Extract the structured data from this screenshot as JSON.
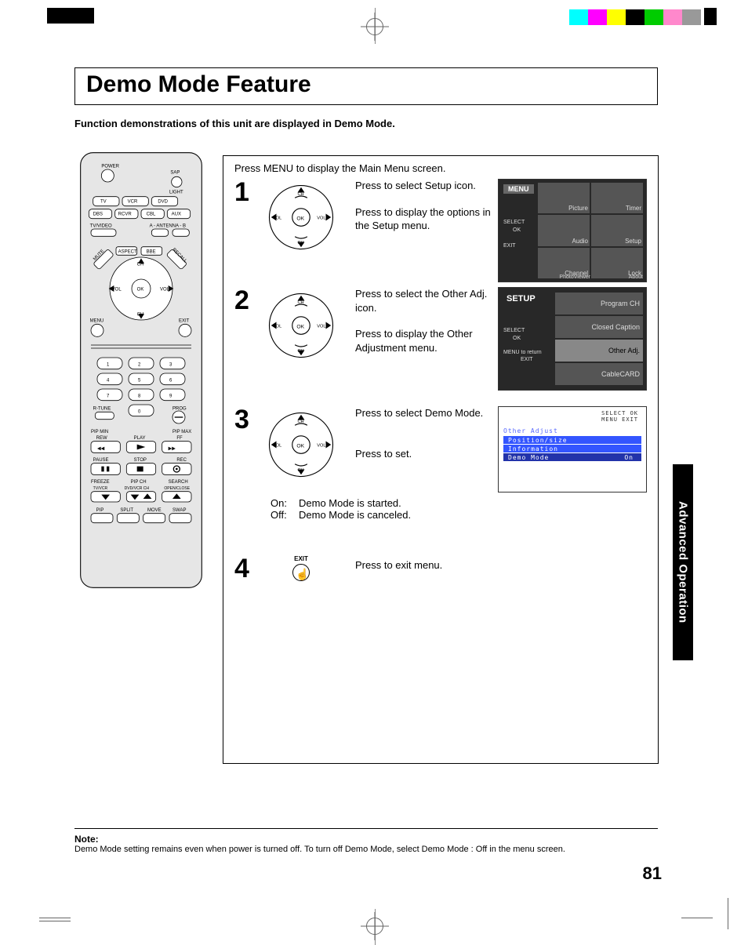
{
  "page": {
    "title": "Demo Mode Feature",
    "subtitle": "Function demonstrations of this unit are displayed in Demo Mode.",
    "page_number": "81",
    "side_tab": "Advanced Operation"
  },
  "intro": "Press MENU to display the Main Menu screen.",
  "steps": [
    {
      "num": "1",
      "text_a": "Press to select Setup icon.",
      "text_b": "Press to display the options in the Setup menu."
    },
    {
      "num": "2",
      "text_a": "Press to select the Other Adj. icon.",
      "text_b": "Press to display the Other Adjustment menu."
    },
    {
      "num": "3",
      "text_a": "Press to select Demo Mode.",
      "text_b": "Press to set."
    },
    {
      "num": "4",
      "text_a": "Press to exit menu."
    }
  ],
  "onoff": {
    "on_label": "On:",
    "on_text": "Demo Mode is started.",
    "off_label": "Off:",
    "off_text": "Demo Mode is canceled."
  },
  "exit_label": "EXIT",
  "nav_labels": {
    "ch": "CH",
    "vol": "VOL",
    "ok": "OK"
  },
  "screen_menu": {
    "header": "MENU",
    "items": [
      "Picture",
      "Timer",
      "Audio",
      "Setup",
      "Channel",
      "Lock",
      "PhotoViewer",
      "About"
    ],
    "side": [
      "SELECT",
      "OK",
      "EXIT"
    ]
  },
  "screen_setup": {
    "header": "SETUP",
    "items": [
      "Program CH",
      "Closed Caption",
      "Other Adj.",
      "CableCARD"
    ],
    "hl_index": 2,
    "side": [
      "SELECT",
      "OK",
      "MENU to return",
      "EXIT"
    ]
  },
  "screen_osd": {
    "legend_top": "SELECT    OK",
    "legend_bot": "MENU    EXIT",
    "title": "Other Adjust",
    "rows": [
      {
        "label": "Position/size",
        "val": ""
      },
      {
        "label": "Information",
        "val": ""
      },
      {
        "label": "Demo Mode",
        "val": "On"
      }
    ]
  },
  "note": {
    "label": "Note:",
    "text": "Demo Mode setting remains even when power is turned off. To turn off Demo Mode, select Demo Mode : Off in the menu screen."
  },
  "remote": {
    "power": "POWER",
    "sap": "SAP",
    "light": "LIGHT",
    "src_row1": [
      "TV",
      "VCR",
      "DVD"
    ],
    "src_row2": [
      "DBS",
      "RCVR",
      "CBL",
      "AUX"
    ],
    "tvvideo": "TV/VIDEO",
    "antenna": "A - ANTENNA - B",
    "mute": "MUTE",
    "aspect": "ASPECT",
    "bbe": "BBE",
    "recall": "RECALL",
    "ch": "CH",
    "vol": "VOL",
    "ok": "OK",
    "menu": "MENU",
    "exit": "EXIT",
    "rtune": "R-TUNE",
    "prog": "PROG",
    "pipmin": "PIP MIN",
    "pipmax": "PIP MAX",
    "rew": "REW",
    "play": "PLAY",
    "ff": "FF",
    "pause": "PAUSE",
    "stop": "STOP",
    "rec": "REC",
    "freeze": "FREEZE",
    "pipch": "PIP CH",
    "search": "SEARCH",
    "tvvcr": "TV/VCR",
    "dvdvcr": "DVD/VCR CH",
    "openclose": "OPEN/CLOSE",
    "pip": "PIP",
    "split": "SPLIT",
    "move": "MOVE",
    "swap": "SWAP",
    "digits": [
      "1",
      "2",
      "3",
      "4",
      "5",
      "6",
      "7",
      "8",
      "9",
      "0"
    ]
  }
}
